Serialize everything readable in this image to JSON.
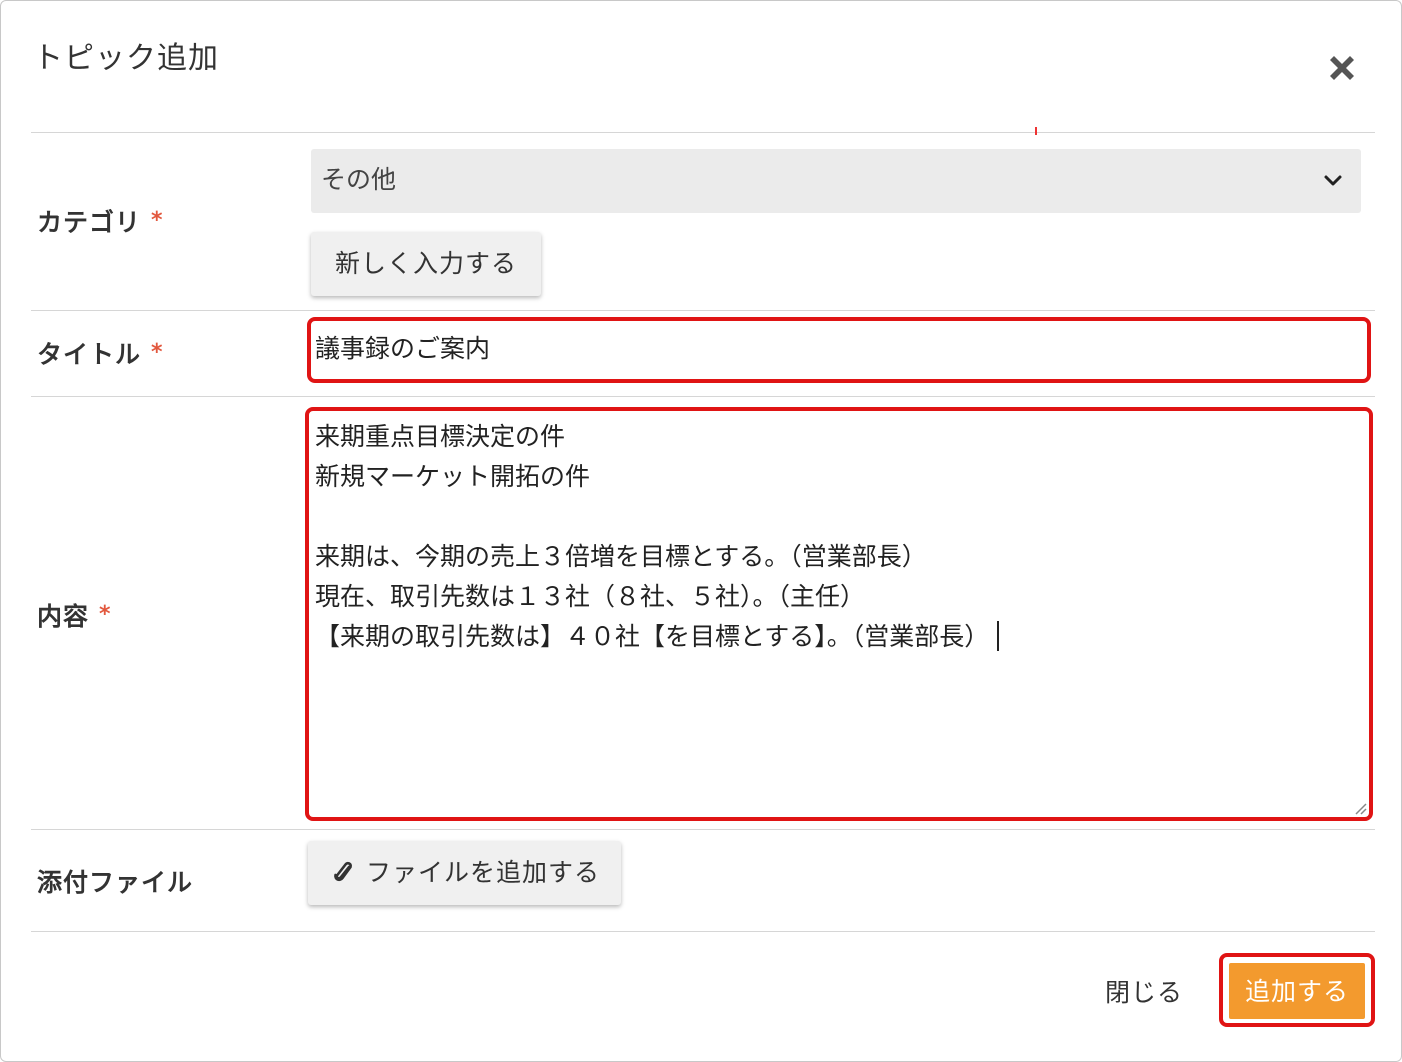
{
  "dialog": {
    "title": "トピック追加",
    "close_icon": "close-icon"
  },
  "category": {
    "label": "カテゴリ",
    "required_mark": "*",
    "selected": "その他",
    "new_input_button": "新しく入力する"
  },
  "title_field": {
    "label": "タイトル",
    "required_mark": "*",
    "value": "議事録のご案内"
  },
  "content_field": {
    "label": "内容",
    "required_mark": "*",
    "lines": [
      "来期重点目標決定の件",
      "新規マーケット開拓の件",
      "",
      "来期は、今期の売上３倍増を目標とする。（営業部長）",
      "現在、取引先数は１３社（８社、５社）。（主任）",
      "【来期の取引先数は】４０社【を目標とする】。（営業部長）"
    ]
  },
  "attachment": {
    "label": "添付ファイル",
    "add_button": "ファイルを追加する",
    "icon": "paperclip-icon"
  },
  "footer": {
    "close_button": "閉じる",
    "submit_button": "追加する"
  },
  "colors": {
    "accent": "#f39a2e",
    "required": "#e2583e",
    "highlight": "#e01414"
  }
}
